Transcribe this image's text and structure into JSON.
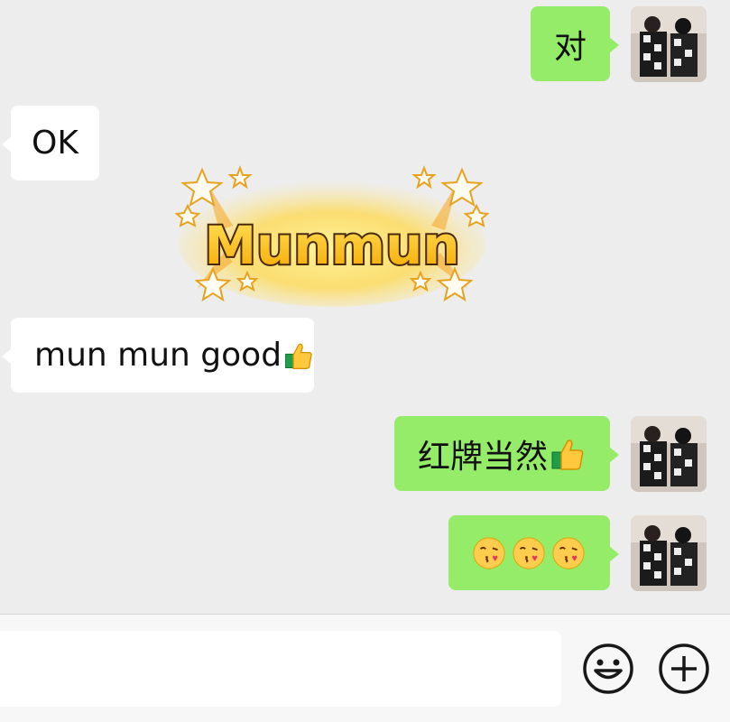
{
  "messages": [
    {
      "side": "out",
      "text": "对"
    },
    {
      "side": "in",
      "text": "OK"
    },
    {
      "side": "in",
      "type": "sticker",
      "text": "Munmun"
    },
    {
      "side": "in",
      "text": "mun mun good",
      "emoji": "thumbs-up"
    },
    {
      "side": "out",
      "text": "红牌当然",
      "emoji": "thumbs-up"
    },
    {
      "side": "out",
      "type": "emoji-only",
      "emoji": [
        "kissing-heart",
        "kissing-heart",
        "kissing-heart"
      ]
    }
  ],
  "input": {
    "value": ""
  },
  "icons": {
    "emoji_button": "smiley-face-icon",
    "more_button": "plus-circle-icon"
  },
  "colors": {
    "out_bubble": "#95ec69",
    "in_bubble": "#ffffff",
    "background": "#ededed"
  }
}
